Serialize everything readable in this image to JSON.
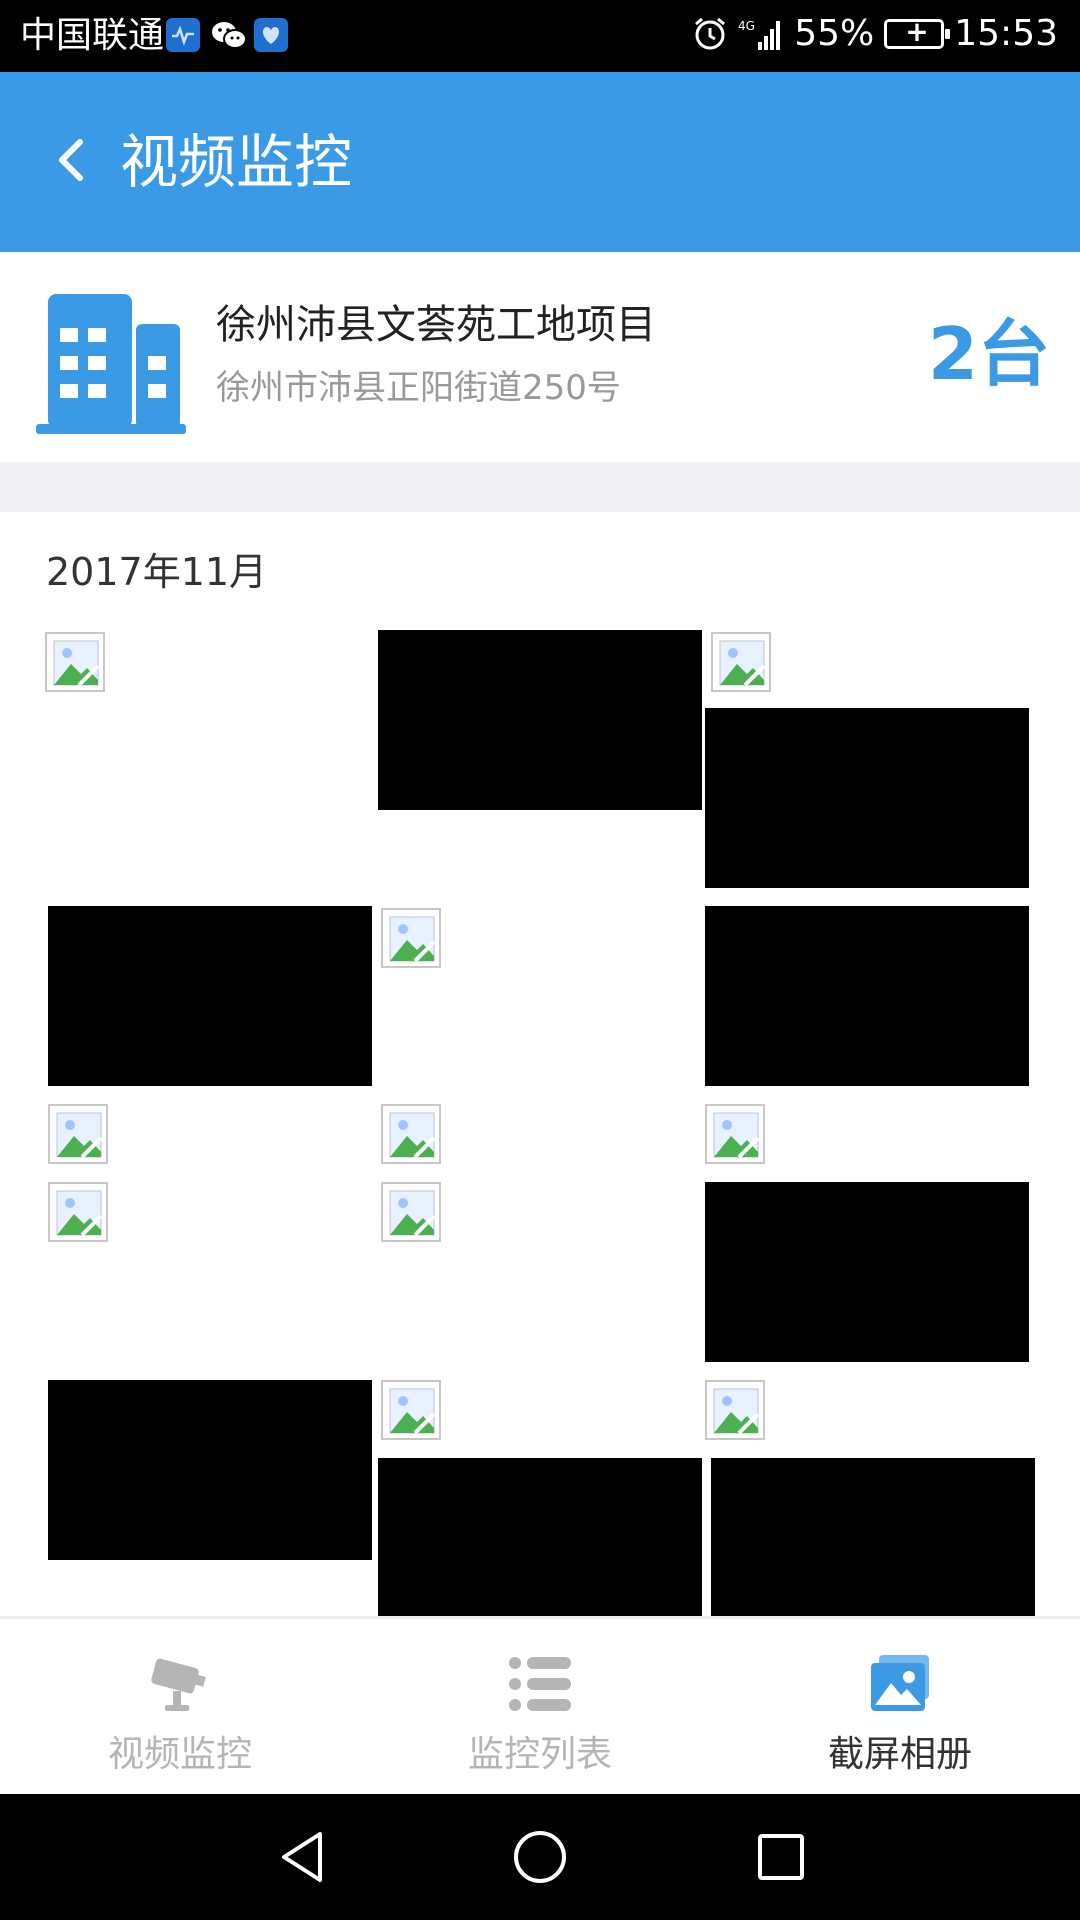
{
  "status_bar": {
    "carrier": "中国联通",
    "battery_percent": "55%",
    "time": "15:53",
    "network": "4G",
    "icons": [
      "health-app-icon",
      "wechat-icon",
      "health-app-icon",
      "alarm-icon",
      "signal-icon",
      "battery-charging-icon"
    ]
  },
  "header": {
    "title": "视频监控",
    "back_icon": "chevron-left-icon"
  },
  "project": {
    "name": "徐州沛县文荟苑工地项目",
    "address": "徐州市沛县正阳街道250号",
    "device_count": "2台",
    "icon": "building-icon"
  },
  "gallery": {
    "month_label": "2017年11月",
    "items": [
      "broken",
      "black",
      "broken+black",
      "black",
      "broken",
      "black",
      "broken",
      "broken",
      "broken",
      "broken",
      "broken",
      "black",
      "black",
      "broken+black",
      "broken+black"
    ]
  },
  "bottom_nav": {
    "items": [
      {
        "label": "视频监控",
        "icon": "camera-icon",
        "active": false
      },
      {
        "label": "监控列表",
        "icon": "list-icon",
        "active": false
      },
      {
        "label": "截屏相册",
        "icon": "photo-album-icon",
        "active": true
      }
    ]
  },
  "colors": {
    "primary": "#3b9ae6",
    "inactive": "#b5b5b5",
    "separator": "#efeff4"
  }
}
